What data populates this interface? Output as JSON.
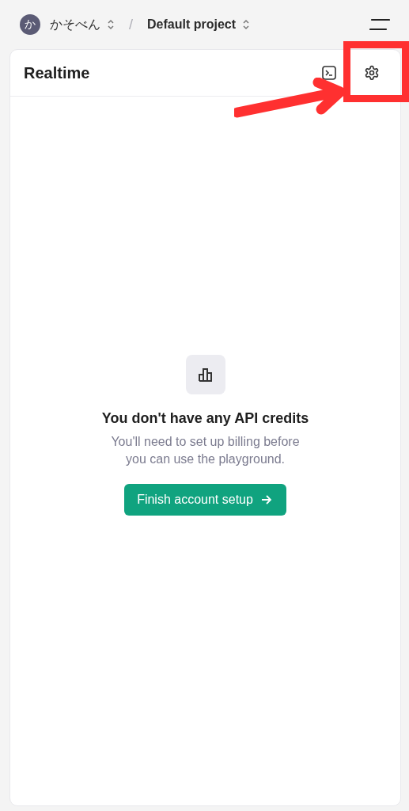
{
  "breadcrumb": {
    "avatar": "か",
    "organization": "かそべん",
    "separator": "/",
    "project": "Default project"
  },
  "panel": {
    "title": "Realtime"
  },
  "empty_state": {
    "title": "You don't have any API credits",
    "message": "You'll need to set up billing before you can use the playground.",
    "button": "Finish account setup"
  }
}
